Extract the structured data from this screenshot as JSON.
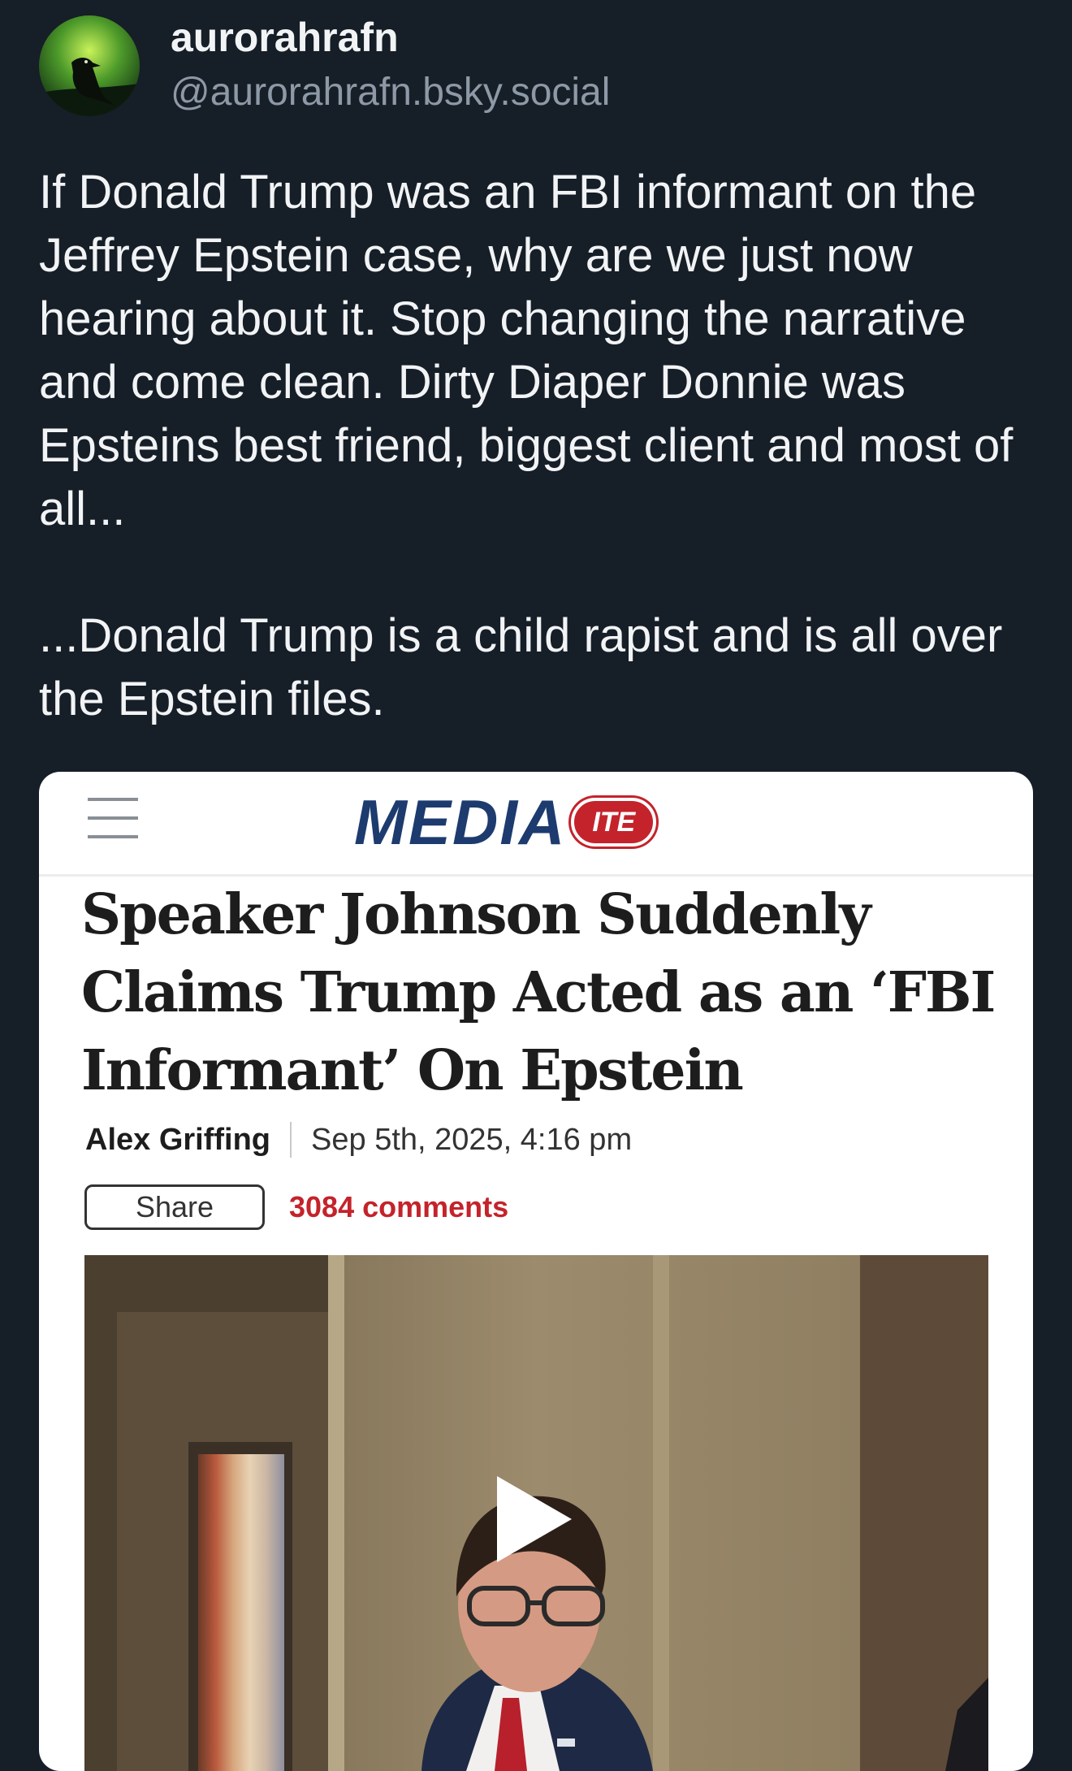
{
  "post": {
    "author": {
      "display_name": "aurorahrafn",
      "handle": "@aurorahrafn.bsky.social"
    },
    "paragraphs": [
      "If Donald Trump was an FBI informant on the Jeffrey Epstein case, why are we just now hearing about it. Stop changing the narrative and come clean. Dirty Diaper Donnie was Epsteins best friend, biggest client and most of all...",
      "...Donald Trump is a child rapist and is all over the Epstein files."
    ]
  },
  "embed": {
    "site": {
      "logo_word": "MEDIA",
      "logo_badge": "ITE"
    },
    "headline": "Speaker Johnson Suddenly Claims Trump Acted as an ‘FBI Informant’ On Epstein",
    "author": "Alex Griffing",
    "date": "Sep 5th, 2025, 4:16 pm",
    "share_label": "Share",
    "comments_label": "3084 comments",
    "video": {
      "icon": "play-icon"
    }
  },
  "colors": {
    "page_background": "#161e27",
    "text_primary": "#f1f3f5",
    "text_secondary": "#8d99a6",
    "brand_navy": "#1d3b6e",
    "brand_red": "#c4232b"
  }
}
